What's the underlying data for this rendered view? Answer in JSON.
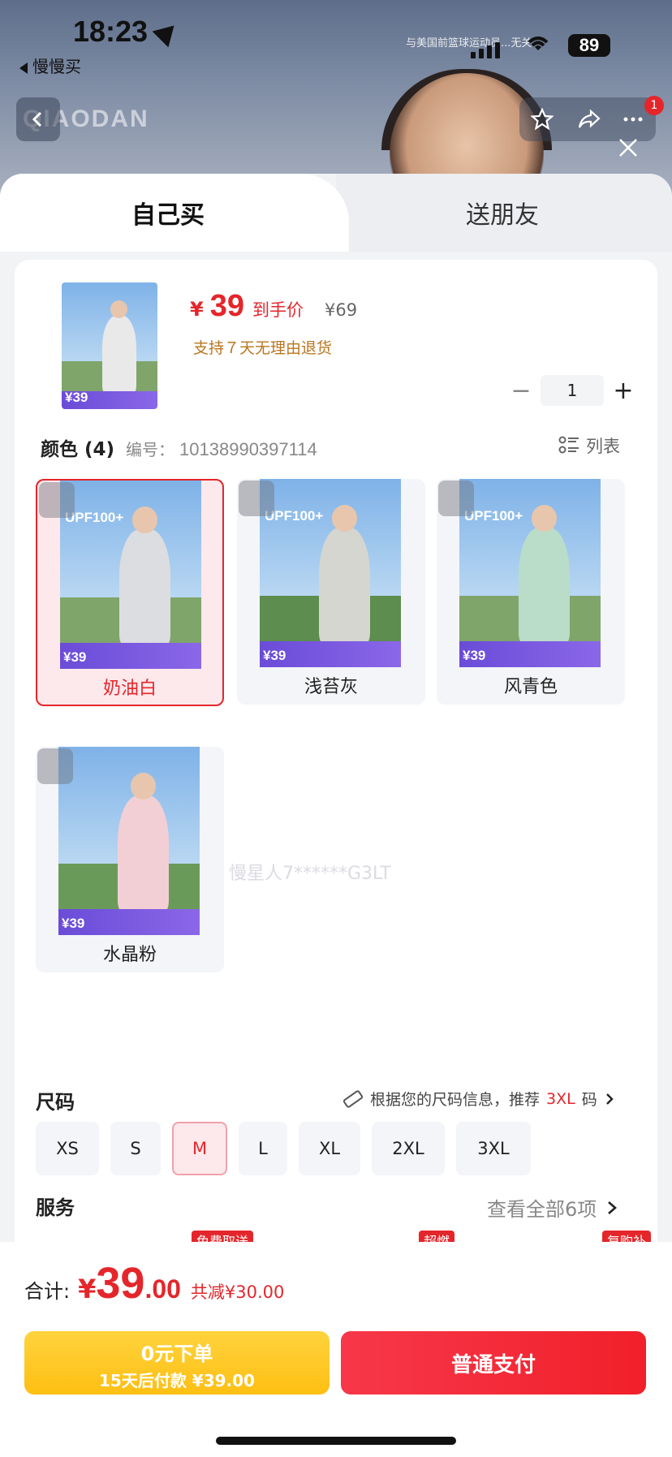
{
  "status": {
    "time": "18:23",
    "battery": "89",
    "back_app": "慢慢买"
  },
  "banner": {
    "logo": "QIAODAN",
    "ad_text": "与美国前篮球运动员...无关",
    "cart_badge": "1"
  },
  "tabs": {
    "self": "自己买",
    "friend": "送朋友"
  },
  "product": {
    "price_symbol": "¥",
    "price": "39",
    "price_tag": "到手价",
    "original_price": "¥69",
    "return_policy": "支持７天无理由退货",
    "quantity": "1",
    "qty_minus": "−",
    "qty_plus": "+"
  },
  "color": {
    "title": "颜色 (4)",
    "sku_label": "编号：",
    "sku": "10138990397114",
    "list_toggle": "列表",
    "options": [
      {
        "label": "奶油白",
        "selected": true
      },
      {
        "label": "浅苔灰",
        "selected": false
      },
      {
        "label": "风青色",
        "selected": false
      },
      {
        "label": "水晶粉",
        "selected": false
      }
    ],
    "poster_upf": "UPF100+",
    "poster_price": "¥39"
  },
  "watermark": "慢星人7******G3LT",
  "size": {
    "title": "尺码",
    "recommend_prefix": "根据您的尺码信息，推荐",
    "recommend_size": "3XL",
    "recommend_suffix": "码",
    "options": [
      "XS",
      "S",
      "M",
      "L",
      "XL",
      "2XL",
      "3XL"
    ],
    "selected": "M"
  },
  "service": {
    "title": "服务",
    "view_all": "查看全部6项",
    "tags": [
      "免费取送",
      "超燃",
      "复购补"
    ]
  },
  "footer": {
    "total_label": "合计:",
    "total_symbol": "¥",
    "total_int": "39",
    "total_dec": ".00",
    "discount": "共减¥30.00",
    "later_line1": "0元下单",
    "later_line2": "15天后付款 ¥39.00",
    "pay_label": "普通支付"
  },
  "colors": {
    "accent": "#e4262b",
    "gold": "#fdbf13",
    "return_text": "#b8761f"
  }
}
